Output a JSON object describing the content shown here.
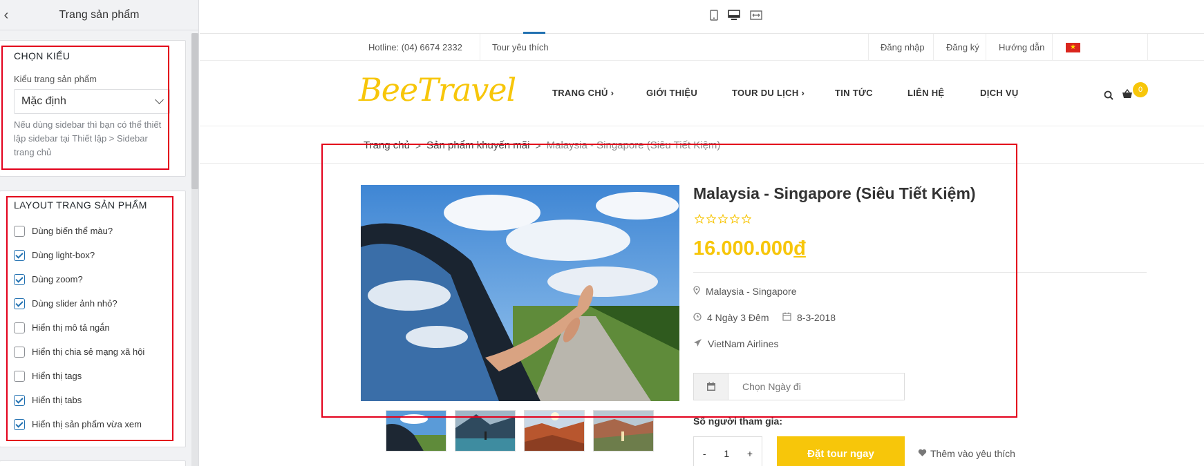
{
  "sidebar": {
    "title": "Trang sản phẩm",
    "section_style": {
      "title": "CHỌN KIỂU",
      "field_label": "Kiểu trang sản phẩm",
      "select_value": "Mặc định",
      "help": "Nếu dùng sidebar thì bạn có thể thiết lập sidebar tại Thiết lập > Sidebar trang chủ"
    },
    "section_layout": {
      "title": "LAYOUT TRANG SẢN PHẨM",
      "options": [
        {
          "label": "Dùng biến thể màu?",
          "checked": false
        },
        {
          "label": "Dùng light-box?",
          "checked": true
        },
        {
          "label": "Dùng zoom?",
          "checked": true
        },
        {
          "label": "Dùng slider ảnh nhỏ?",
          "checked": true
        },
        {
          "label": "Hiển thị mô tả ngắn",
          "checked": false
        },
        {
          "label": "Hiển thị chia sẻ mạng xã hội",
          "checked": false
        },
        {
          "label": "Hiển thị tags",
          "checked": false
        },
        {
          "label": "Hiển thị tabs",
          "checked": true
        },
        {
          "label": "Hiển thị sản phẩm vừa xem",
          "checked": true
        }
      ]
    }
  },
  "preview_toolbar": {
    "devices": [
      "mobile-icon",
      "desktop-icon",
      "full-width-icon"
    ],
    "active_device": "desktop-icon"
  },
  "site": {
    "topbar": {
      "hotline": "Hotline: (04) 6674 2332",
      "favorite": "Tour yêu thích",
      "login": "Đăng nhập",
      "register": "Đăng ký",
      "guide": "Hướng dẫn",
      "flag": "vietnam-flag-icon"
    },
    "logo": "BeeTravel",
    "nav": [
      {
        "label": "TRANG CHỦ",
        "has_sub": true
      },
      {
        "label": "GIỚI THIỆU",
        "has_sub": false
      },
      {
        "label": "TOUR DU LỊCH",
        "has_sub": true
      },
      {
        "label": "TIN TỨC",
        "has_sub": false
      },
      {
        "label": "LIÊN HỆ",
        "has_sub": false
      },
      {
        "label": "DỊCH VỤ",
        "has_sub": false
      }
    ],
    "cart_count": "0",
    "breadcrumb": {
      "home": "Trang chủ",
      "category": "Sản phẩm khuyến mãi",
      "current": "Malaysia - Singapore (Siêu Tiết Kiệm)",
      "separator": ">"
    }
  },
  "product": {
    "title": "Malaysia - Singapore (Siêu Tiết Kiệm)",
    "rating_stars": 0,
    "price_number": "16.000.000",
    "currency": "đ",
    "destination": "Malaysia - Singapore",
    "duration": "4 Ngày 3 Đêm",
    "date": "8-3-2018",
    "airline": "VietNam Airlines",
    "date_placeholder": "Chọn Ngày đi",
    "people_label": "Số người tham gia:",
    "qty_minus": "-",
    "qty_value": "1",
    "qty_plus": "+",
    "book_label": "Đặt tour ngay",
    "wishlist_label": "Thêm vào yêu thích"
  },
  "colors": {
    "accent": "#f7c60a",
    "annotation": "#e3001b",
    "wp_blue": "#2271b1"
  }
}
